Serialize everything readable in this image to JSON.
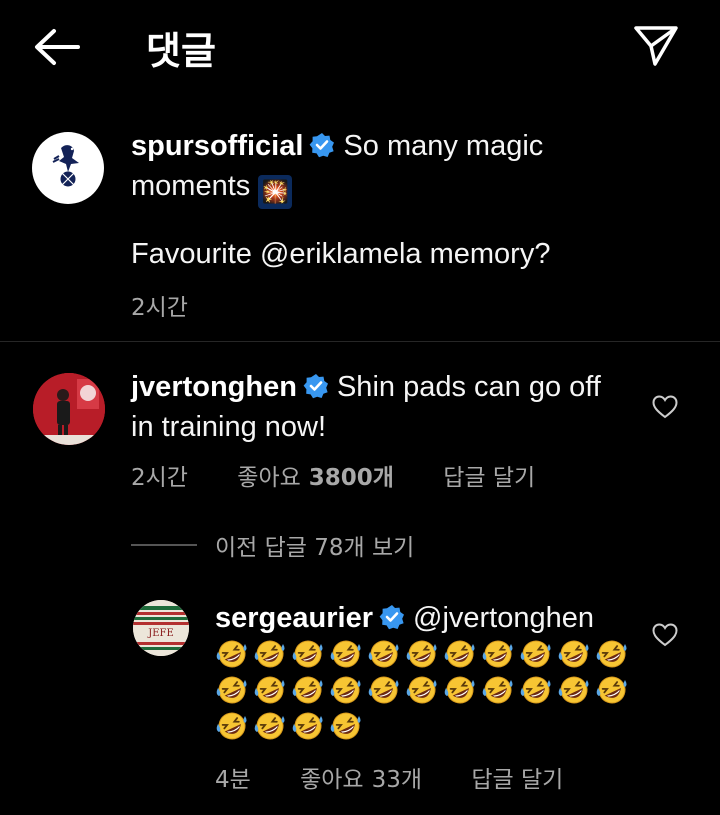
{
  "header": {
    "title": "댓글"
  },
  "post": {
    "username": "spursofficial",
    "caption_line1": "So many magic",
    "caption_line2": "moments",
    "caption_emoji": "🎇",
    "caption_question": "Favourite @eriklamela memory?",
    "time": "2시간"
  },
  "comment": {
    "username": "jvertonghen",
    "text_line1": "Shin pads can go off",
    "text_line2": "in training now!",
    "time": "2시간",
    "likes_prefix": "좋아요",
    "likes_count": "3800개",
    "reply_label": "답글 달기"
  },
  "view_replies": "이전 답글 78개 보기",
  "reply": {
    "username": "sergeaurier",
    "mention": "@jvertonghen",
    "emoji_name": "rolling-on-floor-laughing",
    "emoji_rows": [
      11,
      11,
      4
    ],
    "time": "4분",
    "likes_prefix": "좋아요",
    "likes_count": "33개",
    "reply_label": "답글 달기",
    "avatar_text": "JEFE"
  },
  "colors": {
    "background": "#000000",
    "verified": "#3897f0",
    "meta": "#a8a8a8",
    "spurs_navy": "#132257",
    "benfica_red": "#c8102e"
  },
  "icons": [
    "back-arrow-icon",
    "send-icon",
    "verified-icon",
    "heart-icon",
    "spurs-logo",
    "laughing-emoji-icon"
  ]
}
